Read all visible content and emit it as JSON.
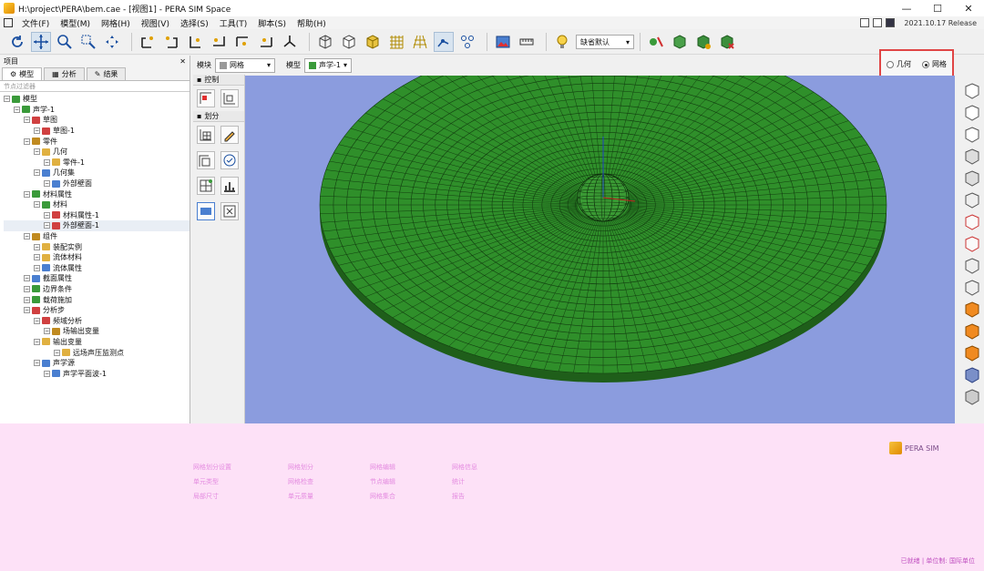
{
  "window": {
    "title": "H:\\project\\PERA\\bem.cae - [视图1] - PERA SIM Space",
    "minimize": "—",
    "maximize": "☐",
    "close": "✕"
  },
  "menu": {
    "items": [
      "文件(F)",
      "模型(M)",
      "网格(H)",
      "视图(V)",
      "选择(S)",
      "工具(T)",
      "脚本(S)",
      "帮助(H)"
    ],
    "version": "2021.10.17 Release"
  },
  "toolbar": {
    "display_mode": "缺省默认"
  },
  "left_panel": {
    "header": "项目",
    "tabs": [
      "模型",
      "分析",
      "结果"
    ],
    "filter_placeholder": "节点过滤器",
    "tree": [
      {
        "label": "模型",
        "level": 0
      },
      {
        "label": "声学-1",
        "level": 1
      },
      {
        "label": "草图",
        "level": 2
      },
      {
        "label": "草图-1",
        "level": 3
      },
      {
        "label": "零件",
        "level": 2
      },
      {
        "label": "几何",
        "level": 3
      },
      {
        "label": "零件-1",
        "level": 4
      },
      {
        "label": "几何集",
        "level": 3
      },
      {
        "label": "外部壁面",
        "level": 4
      },
      {
        "label": "材料属性",
        "level": 2
      },
      {
        "label": "材料",
        "level": 3
      },
      {
        "label": "材料属性-1",
        "level": 4
      },
      {
        "label": "外部壁面-1",
        "level": 4
      },
      {
        "label": "组件",
        "level": 2
      },
      {
        "label": "装配实例",
        "level": 3
      },
      {
        "label": "流体材料",
        "level": 3
      },
      {
        "label": "流体属性",
        "level": 3
      },
      {
        "label": "截面属性",
        "level": 2
      },
      {
        "label": "边界条件",
        "level": 2
      },
      {
        "label": "载荷施加",
        "level": 2
      },
      {
        "label": "分析步",
        "level": 2
      },
      {
        "label": "频域分析",
        "level": 3
      },
      {
        "label": "场输出变量",
        "level": 4
      },
      {
        "label": "输出变量",
        "level": 3
      },
      {
        "label": "远场声压监测点",
        "level": 5
      },
      {
        "label": "声学源",
        "level": 3
      },
      {
        "label": "声学平面波-1",
        "level": 4
      }
    ]
  },
  "module_bar": {
    "module_label": "模块",
    "module_value": "网格",
    "model_label": "模型",
    "model_value": "声学-1"
  },
  "mode_toggle": {
    "option_a": "几何",
    "option_b": "网格",
    "selected": "网格"
  },
  "tool_strip": {
    "control_label": "控制",
    "create_label": "划分"
  },
  "viewport": {
    "background": "#8b9cde",
    "mesh_color": "#2f8f2a"
  },
  "pink_area": {
    "logo_text": "PERA SIM",
    "columns": [
      [
        "网格划分设置",
        "单元类型",
        "局部尺寸"
      ],
      [
        "网格划分",
        "网格检查",
        "单元质量"
      ],
      [
        "网格编辑",
        "节点编辑",
        "网格集合"
      ],
      [
        "网格信息",
        "统计",
        "报告"
      ]
    ],
    "status": "已就绪 | 单位制: 国际单位"
  }
}
